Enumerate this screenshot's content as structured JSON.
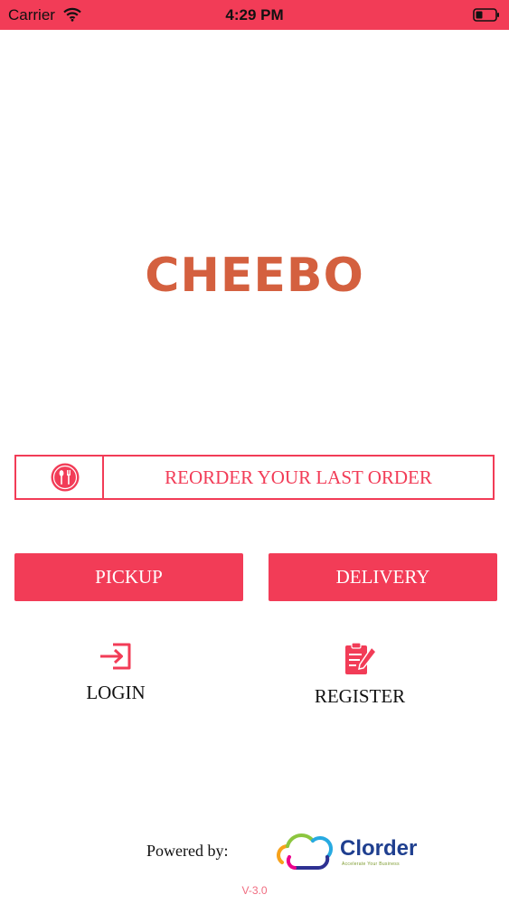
{
  "status_bar": {
    "carrier": "Carrier",
    "time": "4:29 PM",
    "icons": [
      "wifi-icon",
      "battery-icon"
    ]
  },
  "brand": {
    "title": "CHEEBO",
    "color": "#d4603f"
  },
  "reorder": {
    "label": "REORDER YOUR LAST ORDER",
    "icon": "utensils-icon"
  },
  "order_type": {
    "pickup_label": "PICKUP",
    "delivery_label": "DELIVERY"
  },
  "account": {
    "login_label": "LOGIN",
    "login_icon": "login-icon",
    "register_label": "REGISTER",
    "register_icon": "clipboard-icon"
  },
  "footer": {
    "powered_by": "Powered by:",
    "logo_name": "Clorder",
    "logo_tagline": "Accelerate Your Business",
    "version": "V-3.0"
  },
  "colors": {
    "accent": "#f23c57",
    "brand": "#d4603f",
    "logo_blue": "#1f3f8f"
  }
}
